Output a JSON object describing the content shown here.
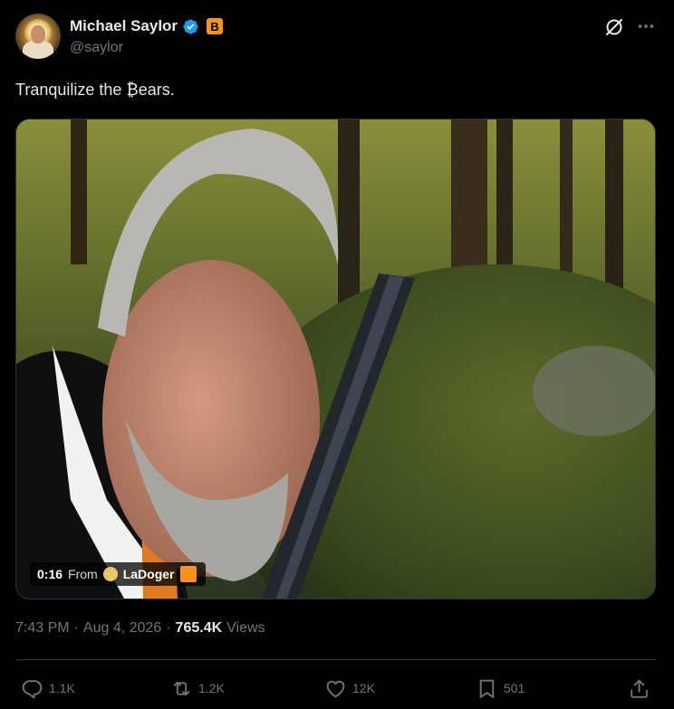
{
  "colors": {
    "background": "#000000",
    "text_primary": "#e7e9ea",
    "text_secondary": "#71767b",
    "verified_blue": "#1d9bf0",
    "bitcoin_orange": "#f7931a",
    "divider": "#2f3336"
  },
  "author": {
    "display_name": "Michael Saylor",
    "handle": "@saylor",
    "verified_icon": "verified-badge-icon",
    "badge_text": "B",
    "avatar_icon": "avatar-image"
  },
  "header_actions": {
    "grok_icon": "grok-icon",
    "more_icon": "more-icon"
  },
  "tweet": {
    "text": "Tranquilize the ₿ears."
  },
  "media": {
    "type": "video",
    "time": "0:16",
    "from_label": "From",
    "source_name": "LaDoger",
    "source_icon": "source-avatar-icon",
    "source_badge_icon": "orange-square-icon"
  },
  "meta": {
    "time": "7:43 PM",
    "separator": "·",
    "date": "Aug 4, 2026",
    "separator2": "·",
    "views_count": "765.4K",
    "views_label": "Views"
  },
  "actions": {
    "reply_count": "1.1K",
    "retweet_count": "1.2K",
    "like_count": "12K",
    "bookmark_count": "501",
    "reply_icon": "reply-icon",
    "retweet_icon": "retweet-icon",
    "like_icon": "heart-icon",
    "bookmark_icon": "bookmark-icon",
    "share_icon": "share-icon"
  }
}
